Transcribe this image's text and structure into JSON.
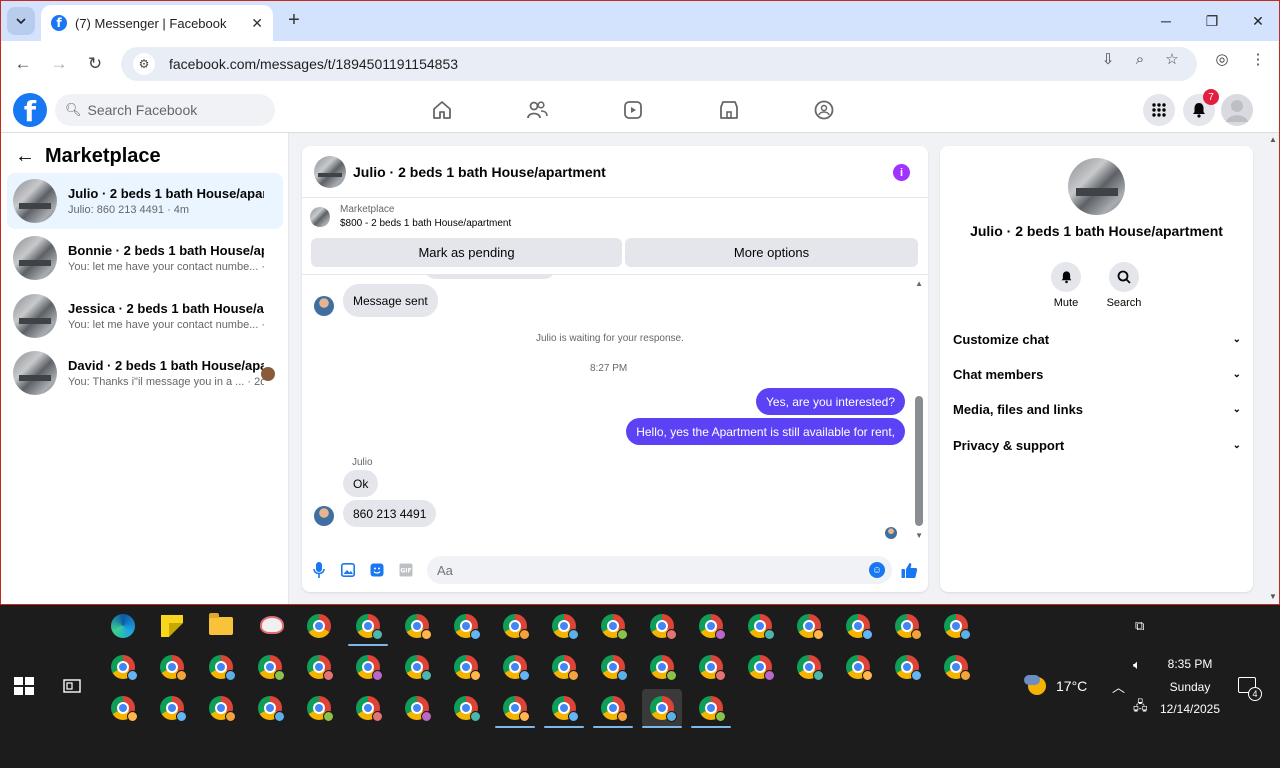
{
  "browser": {
    "tab_title": "(7) Messenger | Facebook",
    "url": "facebook.com/messages/t/1894501191154853"
  },
  "facebook": {
    "search_placeholder": "Search Facebook",
    "notification_count": "7"
  },
  "sidebar": {
    "title": "Marketplace",
    "conversations": [
      {
        "name": "Julio · 2 beds 1 bath House/apart...",
        "preview": "Julio: 860 213 4491 · 4m",
        "active": true
      },
      {
        "name": "Bonnie · 2 beds 1 bath House/apar...",
        "preview": "You: let me have your contact numbe... · 7m",
        "active": false
      },
      {
        "name": "Jessica · 2 beds 1 bath House/apar...",
        "preview": "You: let me have your contact numbe... · 7m",
        "active": false
      },
      {
        "name": "David · 2 beds 1 bath House/apa...",
        "preview": "You: Thanks i\"il message you in a ... · 2d",
        "active": false
      }
    ]
  },
  "chat": {
    "title": "Julio · 2 beds 1 bath House/apartment",
    "marketplace_label": "Marketplace",
    "listing": "$800 - 2 beds 1 bath House/apartment",
    "mark_pending": "Mark as pending",
    "more_options": "More options",
    "messages": {
      "message_sent": "Message sent",
      "waiting": "Julio is waiting for your response.",
      "time": "8:27 PM",
      "out_1": "Yes, are you interested?",
      "out_2": "Hello, yes the Apartment is still available for rent,",
      "sender": "Julio",
      "in_1": "Ok",
      "in_2": "860 213 4491"
    },
    "input_placeholder": "Aa"
  },
  "info_panel": {
    "name": "Julio · 2 beds 1 bath House/apartment",
    "mute_label": "Mute",
    "search_label": "Search",
    "sections": [
      "Customize chat",
      "Chat members",
      "Media, files and links",
      "Privacy & support"
    ]
  },
  "taskbar": {
    "temperature": "17°C",
    "time": "8:35 PM",
    "day": "Sunday",
    "date": "12/14/2025",
    "notifications": "4"
  },
  "colors": {
    "facebook_blue": "#1877f2",
    "outgoing_bubble": "#5b43f5",
    "active_conversation": "#ebf5ff",
    "notification_red": "#e41e3f"
  }
}
